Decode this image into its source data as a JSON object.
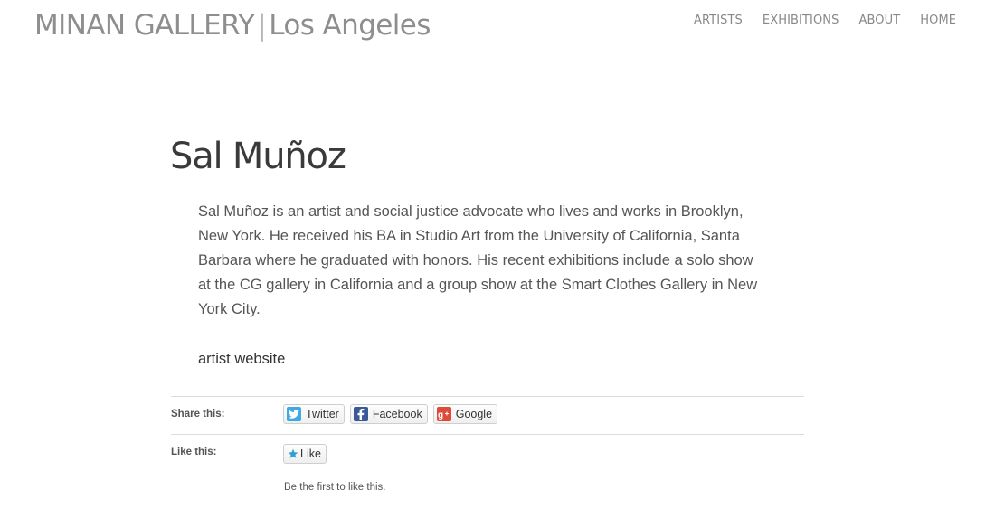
{
  "header": {
    "site_name": "MINAN GALLERY",
    "separator": "|",
    "location": "Los Angeles",
    "nav": [
      {
        "label": "ARTISTS"
      },
      {
        "label": "EXHIBITIONS"
      },
      {
        "label": "ABOUT"
      },
      {
        "label": "HOME"
      }
    ]
  },
  "artist": {
    "name": "Sal Muñoz",
    "bio": "Sal Muñoz is an artist and social justice advocate who lives and works in Brooklyn, New York. He received his BA in Studio Art from the University of California, Santa Barbara where he graduated with honors. His recent exhibitions include a solo show at the CG gallery in California and a group show at the Smart Clothes Gallery in New York City.",
    "website_link": "artist website"
  },
  "sharing": {
    "share_label": "Share this:",
    "buttons": [
      {
        "label": "Twitter",
        "icon": "twitter-icon",
        "color": "#3fa9e4"
      },
      {
        "label": "Facebook",
        "icon": "facebook-icon",
        "color": "#3b5998"
      },
      {
        "label": "Google",
        "icon": "google-plus-icon",
        "color": "#dd4b39"
      }
    ],
    "like_label": "Like this:",
    "like_button": "Like",
    "like_note": "Be the first to like this."
  }
}
